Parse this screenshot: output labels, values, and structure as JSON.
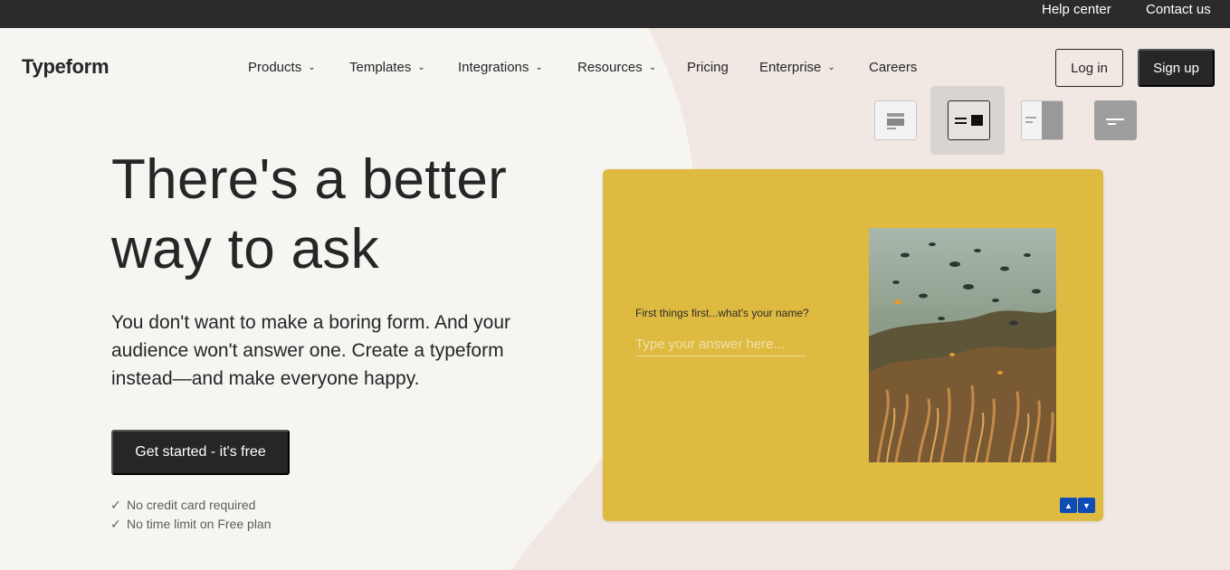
{
  "topbar": {
    "help": "Help center",
    "contact": "Contact us"
  },
  "brand": {
    "logo": "Typeform"
  },
  "nav": {
    "items": [
      {
        "label": "Products",
        "dropdown": true
      },
      {
        "label": "Templates",
        "dropdown": true
      },
      {
        "label": "Integrations",
        "dropdown": true
      },
      {
        "label": "Resources",
        "dropdown": true
      },
      {
        "label": "Pricing",
        "dropdown": false
      },
      {
        "label": "Enterprise",
        "dropdown": true
      },
      {
        "label": "Careers",
        "dropdown": false
      }
    ],
    "login": "Log in",
    "signup": "Sign up"
  },
  "hero": {
    "title": "There's a better way to ask",
    "subtitle": "You don't want to make a boring form. And your audience won't answer one. Create a typeform instead—and make everyone happy.",
    "cta": "Get started - it's free",
    "perks": [
      "No credit card required",
      "No time limit on Free plan"
    ]
  },
  "preview": {
    "question": "First things first...what's your name?",
    "placeholder": "Type your answer here...",
    "active_layout": 1
  },
  "colors": {
    "topbar": "#2b2b2b",
    "dark": "#262627",
    "preview_bg": "#debb40",
    "nav_arrow": "#0e4db8",
    "page_bg": "#f7f5f2"
  }
}
